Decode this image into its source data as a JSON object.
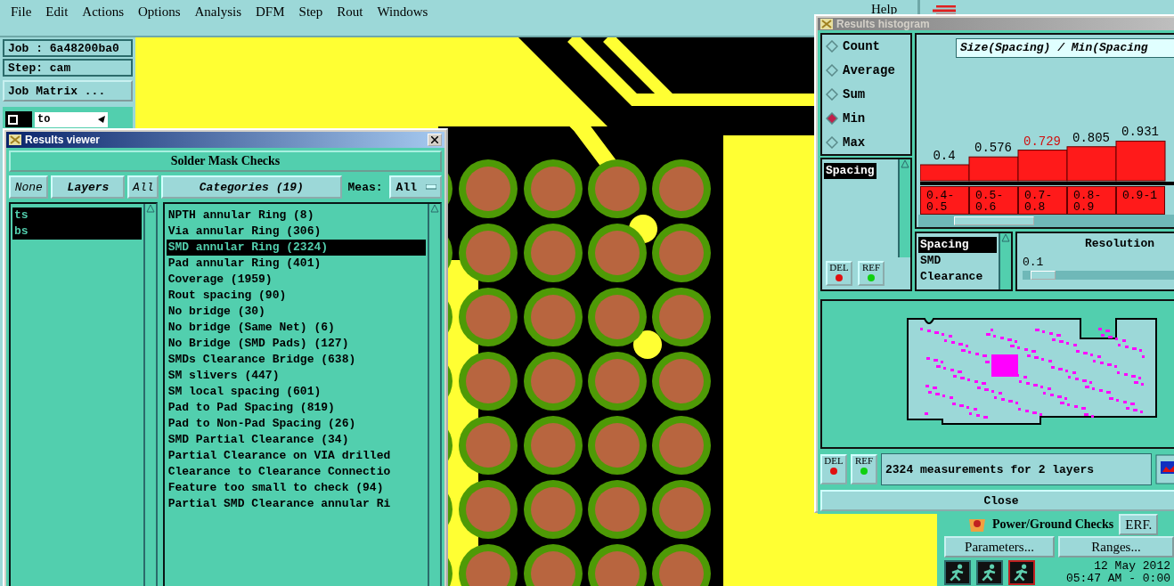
{
  "menu": [
    {
      "label": "File"
    },
    {
      "label": "Edit"
    },
    {
      "label": "Actions"
    },
    {
      "label": "Options"
    },
    {
      "label": "Analysis"
    },
    {
      "label": "DFM"
    },
    {
      "label": "Step"
    },
    {
      "label": "Rout"
    },
    {
      "label": "Windows"
    }
  ],
  "help": "Help",
  "job_panel": {
    "job": "Job : 6a48200ba0",
    "step": "Step: cam",
    "matrix_button": "Job Matrix ...",
    "layer_value": "to"
  },
  "results_viewer": {
    "title": "Results viewer",
    "heading": "Solder Mask Checks",
    "none_button": "None",
    "layers_button": "Layers",
    "all_button": "All",
    "categories_button": "Categories (19)",
    "meas_label": "Meas:",
    "meas_value": "All",
    "layers": [
      {
        "label": "ts",
        "selected": true
      },
      {
        "label": "bs",
        "selected": true
      }
    ],
    "categories": [
      {
        "label": "NPTH annular Ring (8)",
        "selected": false
      },
      {
        "label": "Via annular Ring (306)",
        "selected": false
      },
      {
        "label": "SMD annular Ring (2324)",
        "selected": true
      },
      {
        "label": "Pad annular Ring (401)",
        "selected": false
      },
      {
        "label": "Coverage (1959)",
        "selected": false
      },
      {
        "label": "Rout spacing (90)",
        "selected": false
      },
      {
        "label": "No bridge (30)",
        "selected": false
      },
      {
        "label": "No bridge (Same Net) (6)",
        "selected": false
      },
      {
        "label": "No Bridge (SMD Pads) (127)",
        "selected": false
      },
      {
        "label": "SMDs Clearance Bridge (638)",
        "selected": false
      },
      {
        "label": "SM slivers (447)",
        "selected": false
      },
      {
        "label": "SM local spacing (601)",
        "selected": false
      },
      {
        "label": "Pad to Pad Spacing (819)",
        "selected": false
      },
      {
        "label": "Pad to Non-Pad Spacing (26)",
        "selected": false
      },
      {
        "label": "SMD Partial Clearance (34)",
        "selected": false
      },
      {
        "label": "Partial Clearance on VIA drilled",
        "selected": false
      },
      {
        "label": "Clearance to Clearance Connectio",
        "selected": false
      },
      {
        "label": "Feature too small to check (94)",
        "selected": false
      },
      {
        "label": "Partial SMD Clearance annular Ri",
        "selected": false
      }
    ]
  },
  "histogram": {
    "title": "Results histogram",
    "modes": [
      {
        "label": "Count",
        "selected": false
      },
      {
        "label": "Average",
        "selected": false
      },
      {
        "label": "Sum",
        "selected": false
      },
      {
        "label": "Min",
        "selected": true
      },
      {
        "label": "Max",
        "selected": false
      }
    ],
    "measures": [
      {
        "label": "Spacing",
        "selected": true
      }
    ],
    "del_button": "DEL",
    "ref_button": "REF",
    "chart_data": {
      "type": "bar",
      "title": "Size(Spacing) / Min(Spacing",
      "categories": [
        "0.4-0.5",
        "0.5-0.6",
        "0.7-0.8",
        "0.8-0.9",
        "0.9-1"
      ],
      "values": [
        0.4,
        0.576,
        0.729,
        0.805,
        0.931
      ],
      "data_labels": true
    },
    "highlighted_bars": [
      false,
      false,
      true,
      false,
      false
    ],
    "attributes": [
      {
        "label": "Spacing",
        "selected": true
      },
      {
        "label": "SMD",
        "selected": false
      },
      {
        "label": "Clearance",
        "selected": false
      }
    ],
    "resolution_label": "Resolution",
    "resolution_value": "0.1",
    "resolution": {
      "level": 0.05
    },
    "map_del_button": "DEL",
    "map_ref_button": "REF",
    "status": "2324 measurements for 2 layers",
    "close_button": "Close"
  },
  "right_panel": {
    "check_label": "Power/Ground Checks",
    "erf_button": "ERF.",
    "parameters_button": "Parameters...",
    "ranges_button": "Ranges...",
    "date": "12 May 2012",
    "time": "05:47 AM - 0:00"
  }
}
